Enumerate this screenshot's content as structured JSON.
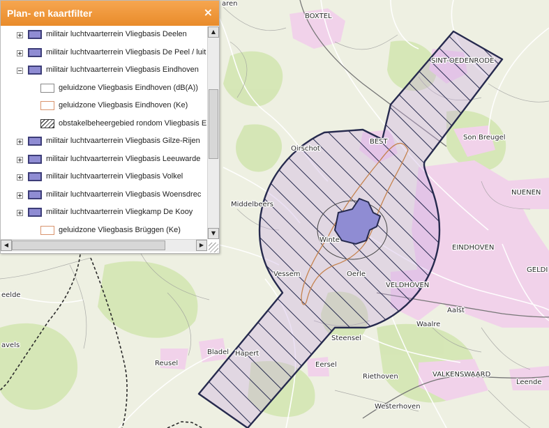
{
  "panel": {
    "title": "Plan- en kaartfilter",
    "close_icon": "×",
    "items": [
      {
        "expand": "plus",
        "swatch": "military",
        "label": "militair luchtvaarterrein Vliegbasis Deelen"
      },
      {
        "expand": "plus",
        "swatch": "military",
        "label": "militair luchtvaarterrein Vliegbasis De Peel / luit"
      },
      {
        "expand": "minus",
        "swatch": "military",
        "label": "militair luchtvaarterrein Vliegbasis Eindhoven"
      },
      {
        "expand": "none",
        "swatch": "white",
        "label": "geluidzone Vliegbasis Eindhoven (dB(A))"
      },
      {
        "expand": "none",
        "swatch": "orange",
        "label": "geluidzone Vliegbasis Eindhoven (Ke)"
      },
      {
        "expand": "none",
        "swatch": "hatch",
        "label": "obstakelbeheergebied rondom Vliegbasis E"
      },
      {
        "expand": "plus",
        "swatch": "military",
        "label": "militair luchtvaarterrein Vliegbasis Gilze-Rijen"
      },
      {
        "expand": "plus",
        "swatch": "military",
        "label": "militair luchtvaarterrein Vliegbasis Leeuwarde"
      },
      {
        "expand": "plus",
        "swatch": "military",
        "label": "militair luchtvaarterrein Vliegbasis Volkel"
      },
      {
        "expand": "plus",
        "swatch": "military",
        "label": "militair luchtvaarterrein Vliegbasis Woensdrec"
      },
      {
        "expand": "plus",
        "swatch": "military",
        "label": "militair luchtvaarterrein Vliegkamp De Kooy"
      },
      {
        "expand": "none",
        "swatch": "orange",
        "label": "geluidzone Vliegbasis Brüggen (Ke)"
      }
    ]
  },
  "map": {
    "places": {
      "boxtel": "BOXTEL",
      "sint_oedenrode": "SINT-OEDENRODE",
      "son_breugel": "Son Breugel",
      "best": "BEST",
      "oirschot": "Oirschot",
      "nuenen": "NUENEN",
      "middelbeers": "Middelbeers",
      "wintelre": "Winte",
      "eindhoven": "EINDHOVEN",
      "geldrop": "GELDI",
      "vessem": "Vessem",
      "oerle": "Oerle",
      "veldhoven": "VELDHOVEN",
      "aalst": "Aalst",
      "waalre": "Waalre",
      "eelde": "eelde",
      "steensel": "Steensel",
      "lavels": "avels",
      "bladel": "Bladel",
      "hapert": "Hapert",
      "reusel": "Reusel",
      "eersel": "Eersel",
      "riethoven": "Riethoven",
      "valkenswaard": "VALKENSWAARD",
      "leende": "Leende",
      "westerhoven": "Westerhoven",
      "top_partial": "aren"
    },
    "colors": {
      "background": "#eef0e2",
      "urban": "#f1d2ea",
      "forest": "#d3e6b2",
      "road": "#ffffff",
      "zone_fill": "#e2d4ee",
      "hatch": "#262a4e",
      "airbase": "#8f8cd3",
      "noise_contour": "#c5834f"
    }
  }
}
